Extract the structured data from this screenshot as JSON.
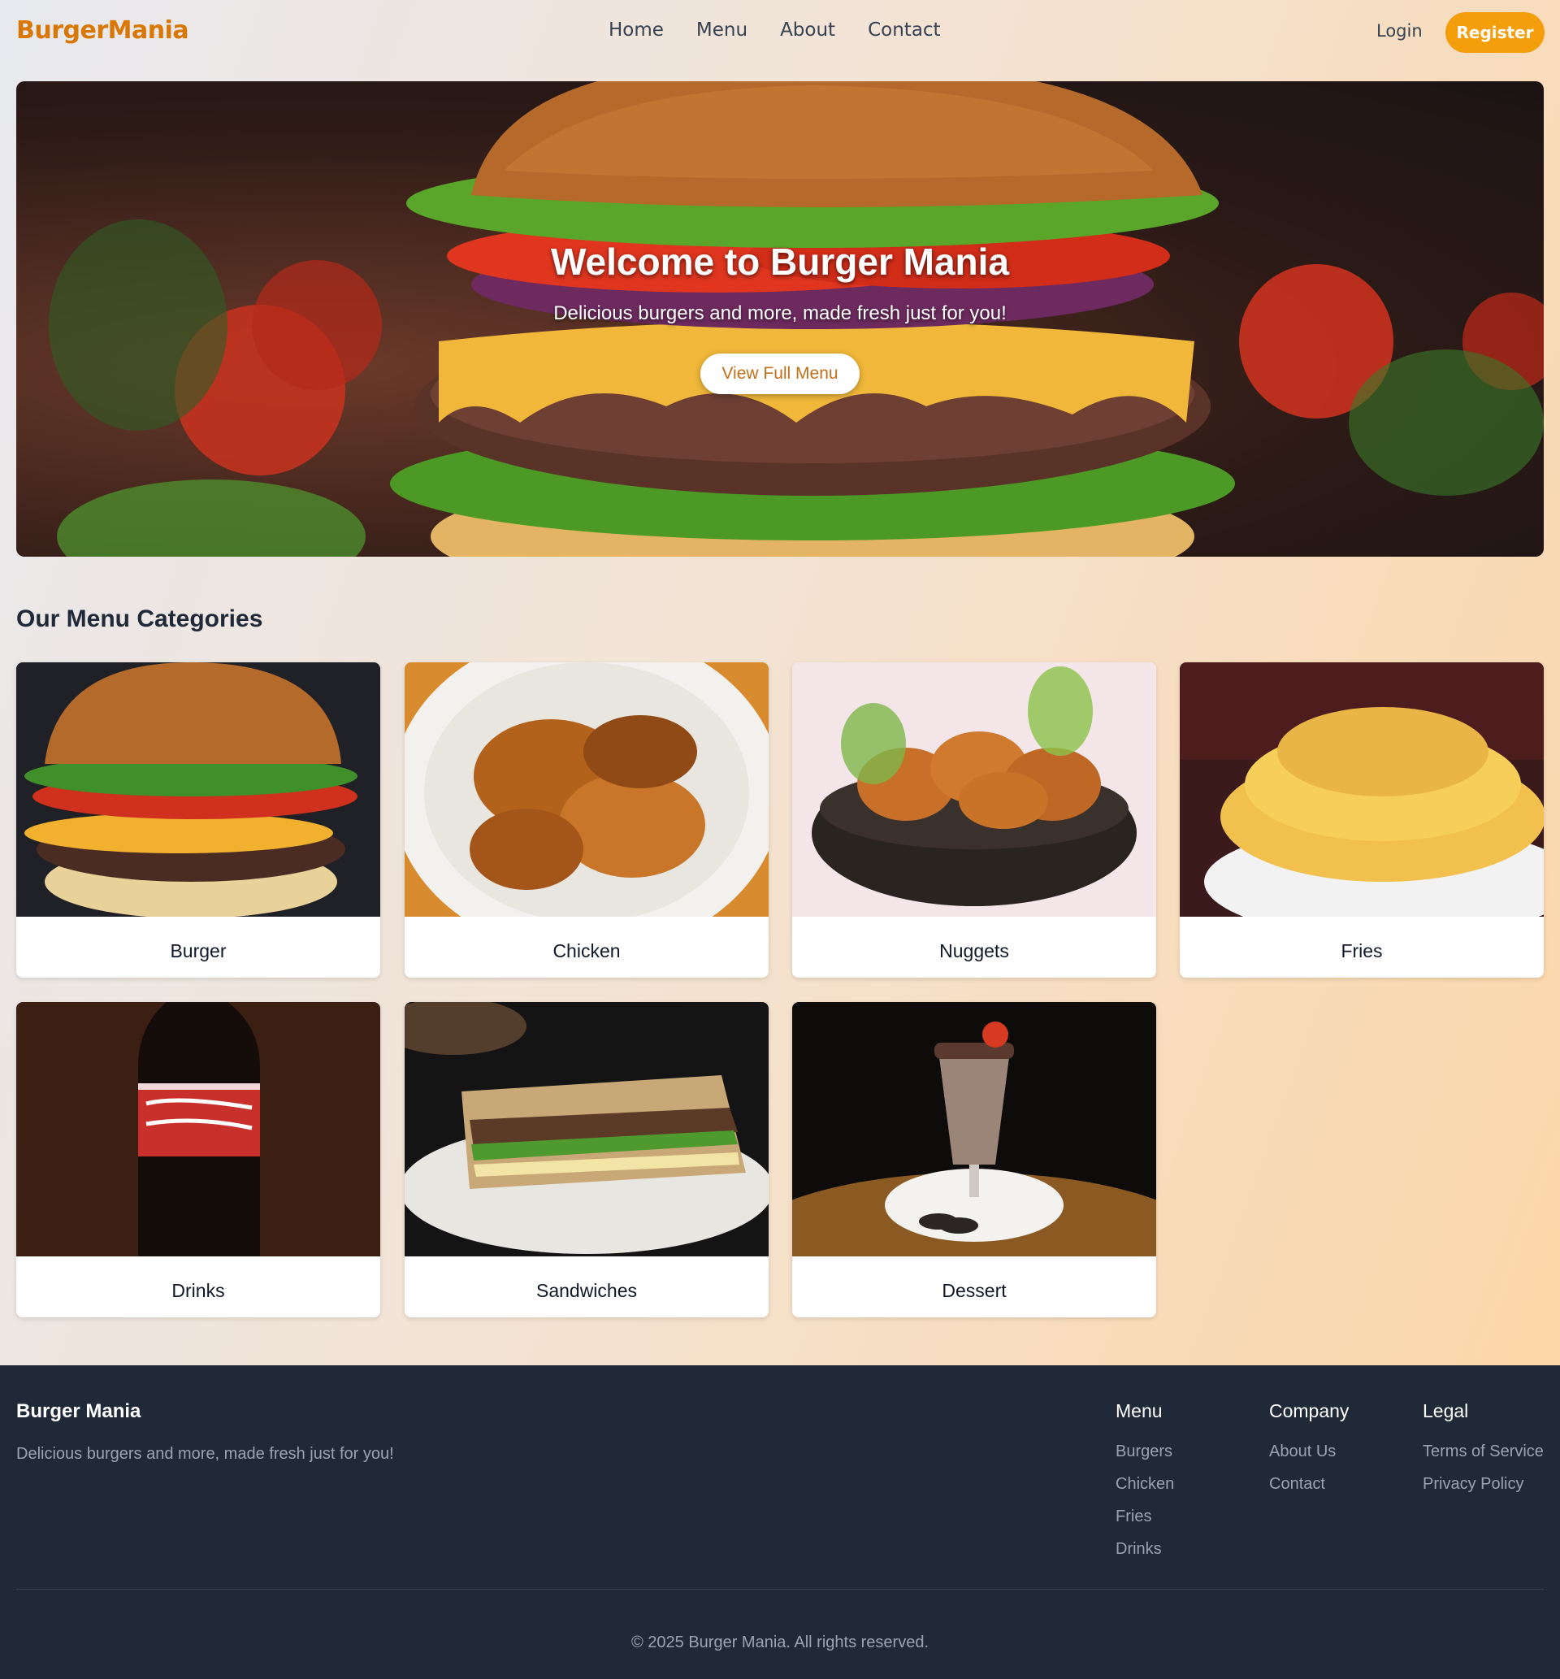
{
  "nav": {
    "logo": "BurgerMania",
    "links": [
      "Home",
      "Menu",
      "About",
      "Contact"
    ],
    "login": "Login",
    "register": "Register"
  },
  "hero": {
    "title": "Welcome to Burger Mania",
    "subtitle": "Delicious burgers and more, made fresh just for you!",
    "cta": "View Full Menu"
  },
  "categories": {
    "title": "Our Menu Categories",
    "items": [
      {
        "label": "Burger",
        "image": "burger-photo"
      },
      {
        "label": "Chicken",
        "image": "chicken-photo"
      },
      {
        "label": "Nuggets",
        "image": "nuggets-photo"
      },
      {
        "label": "Fries",
        "image": "fries-photo"
      },
      {
        "label": "Drinks",
        "image": "cola-bottle-photo"
      },
      {
        "label": "Sandwiches",
        "image": "sandwich-photo"
      },
      {
        "label": "Dessert",
        "image": "milkshake-photo"
      }
    ]
  },
  "footer": {
    "brand": "Burger Mania",
    "tagline": "Delicious burgers and more, made fresh just for you!",
    "columns": [
      {
        "title": "Menu",
        "links": [
          "Burgers",
          "Chicken",
          "Fries",
          "Drinks"
        ]
      },
      {
        "title": "Company",
        "links": [
          "About Us",
          "Contact"
        ]
      },
      {
        "title": "Legal",
        "links": [
          "Terms of Service",
          "Privacy Policy"
        ]
      }
    ],
    "copyright": "© 2025 Burger Mania. All rights reserved."
  },
  "colors": {
    "accent": "#f59e0b",
    "logo": "#d97706",
    "footer_bg": "#1f2937",
    "footer_text": "#9ca3af"
  }
}
